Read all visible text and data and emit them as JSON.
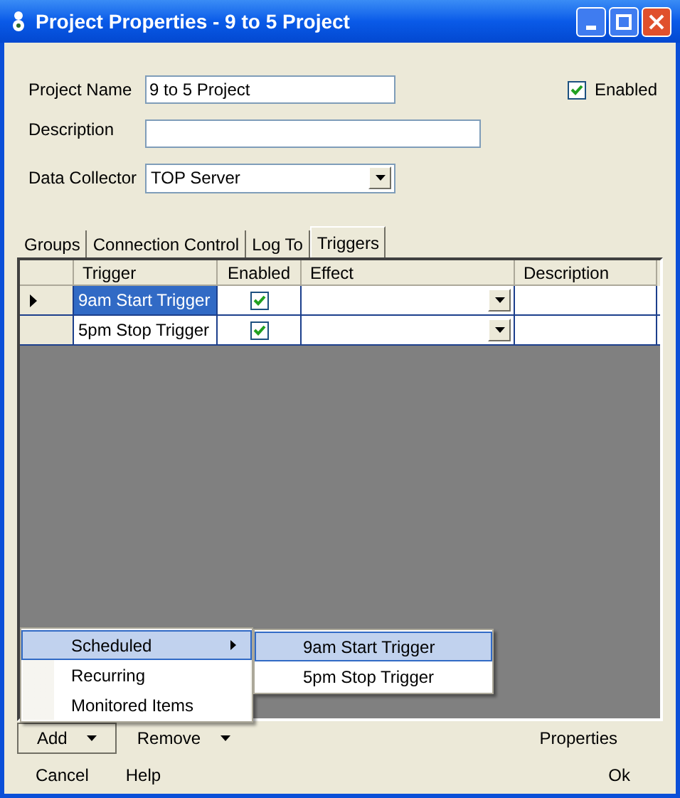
{
  "window": {
    "title": "Project Properties - 9 to 5 Project"
  },
  "form": {
    "project_name": {
      "label": "Project Name",
      "value": "9 to 5 Project"
    },
    "enabled": {
      "label": "Enabled",
      "checked": true
    },
    "description": {
      "label": "Description"
    },
    "data_collector": {
      "label": "Data Collector",
      "value": "TOP Server"
    }
  },
  "tabs": [
    {
      "label": "Groups",
      "selected": false
    },
    {
      "label": "Connection Control",
      "selected": false
    },
    {
      "label": "Log To",
      "selected": false
    },
    {
      "label": "Triggers",
      "selected": true
    }
  ],
  "table": {
    "columns": [
      "Trigger",
      "Enabled",
      "Effect",
      "Description"
    ],
    "rows": [
      {
        "trigger": "9am Start Trigger",
        "enabled": true,
        "current": true,
        "selected": true
      },
      {
        "trigger": "5pm Stop Trigger",
        "enabled": true,
        "current": false,
        "selected": false
      }
    ]
  },
  "menu": {
    "items": [
      {
        "label": "Scheduled",
        "has_submenu": true,
        "selected": true
      },
      {
        "label": "Recurring",
        "has_submenu": false,
        "selected": false
      },
      {
        "label": "Monitored Items",
        "has_submenu": false,
        "selected": false
      }
    ],
    "submenu": [
      {
        "label": "9am Start Trigger",
        "selected": true
      },
      {
        "label": "5pm Stop Trigger",
        "selected": false
      }
    ]
  },
  "toolbar": [
    {
      "label": "Add",
      "dropdown": true,
      "pressed": true
    },
    {
      "label": "Remove",
      "dropdown": true,
      "pressed": false
    },
    {
      "label": "Properties",
      "dropdown": false,
      "pressed": false
    }
  ],
  "buttons": [
    "Cancel",
    "Help",
    "Ok"
  ]
}
